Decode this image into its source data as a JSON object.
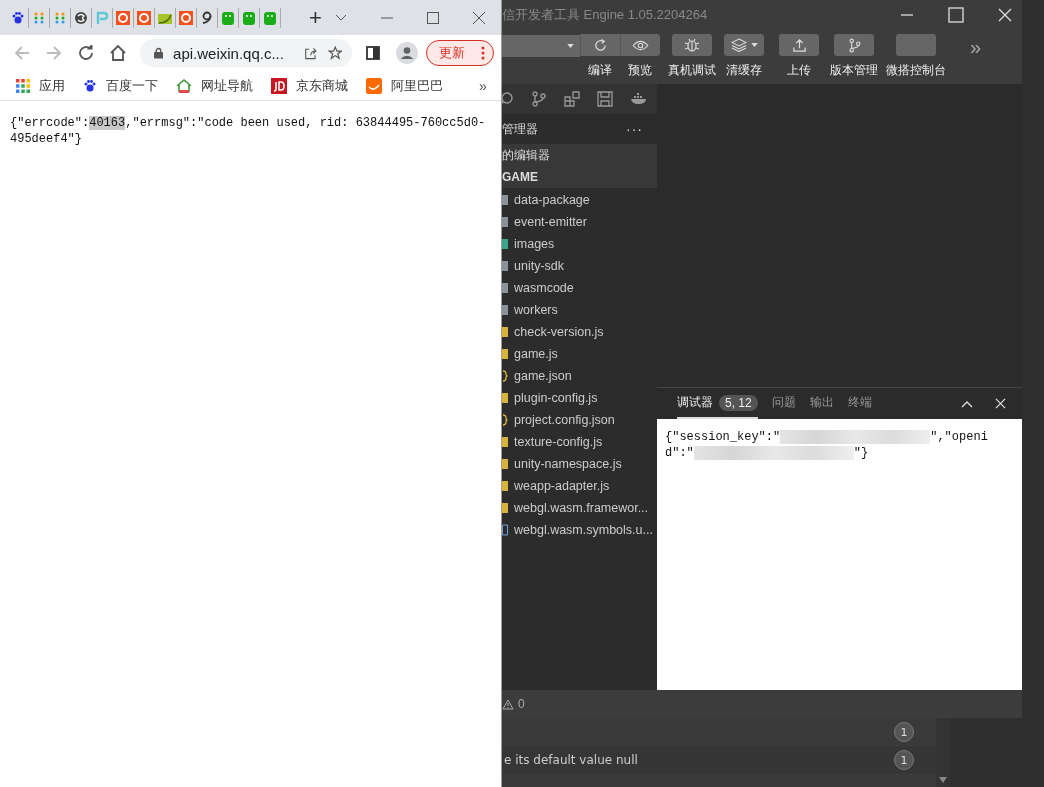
{
  "browser": {
    "tabs": [
      {
        "kind": "paw"
      },
      {
        "kind": "dots"
      },
      {
        "kind": "dots"
      },
      {
        "kind": "swirl"
      },
      {
        "kind": "p"
      },
      {
        "kind": "ring"
      },
      {
        "kind": "ring"
      },
      {
        "kind": "leaf"
      },
      {
        "kind": "ring"
      },
      {
        "kind": "nine"
      },
      {
        "kind": "android"
      },
      {
        "kind": "android"
      },
      {
        "kind": "android"
      }
    ],
    "new_tab": "+",
    "address": "api.weixin.qq.c...",
    "update_button": "更新",
    "bookmarks": [
      {
        "kind": "apps",
        "label": "应用"
      },
      {
        "kind": "paw",
        "label": "百度一下"
      },
      {
        "kind": "house",
        "label": "网址导航"
      },
      {
        "kind": "jd",
        "label": "京东商城"
      },
      {
        "kind": "ali",
        "label": "阿里巴巴"
      }
    ],
    "more": "»",
    "response": {
      "before": "{\"errcode\":",
      "highlight": "40163",
      "after": ",\"errmsg\":\"code been used, rid: 63844495-760cc5d0-495deef4\"}"
    }
  },
  "devtools": {
    "title": "信开发者工具 Engine 1.05.2204264",
    "toolbar": [
      {
        "kind": "compile",
        "label": "编译"
      },
      {
        "kind": "preview",
        "label": "预览"
      },
      {
        "kind": "debug",
        "label": "真机调试"
      },
      {
        "kind": "cache",
        "label": "清缓存"
      },
      {
        "kind": "upload",
        "label": "上传"
      },
      {
        "kind": "branch",
        "label": "版本管理"
      },
      {
        "kind": "blank",
        "label": "微搭控制台"
      }
    ],
    "overflow": "»",
    "explorer": {
      "title": "管理器",
      "menu": "···",
      "open_editors": "的编辑器",
      "folder": "GAME",
      "files": [
        {
          "kind": "folder",
          "name": "data-package"
        },
        {
          "kind": "folder",
          "name": "event-emitter"
        },
        {
          "kind": "image",
          "name": "images"
        },
        {
          "kind": "folder",
          "name": "unity-sdk"
        },
        {
          "kind": "folder",
          "name": "wasmcode"
        },
        {
          "kind": "folder",
          "name": "workers"
        },
        {
          "kind": "js",
          "name": "check-version.js"
        },
        {
          "kind": "js",
          "name": "game.js"
        },
        {
          "kind": "json",
          "name": "game.json"
        },
        {
          "kind": "js",
          "name": "plugin-config.js"
        },
        {
          "kind": "json",
          "name": "project.config.json"
        },
        {
          "kind": "js",
          "name": "texture-config.js"
        },
        {
          "kind": "js",
          "name": "unity-namespace.js"
        },
        {
          "kind": "js",
          "name": "weapp-adapter.js"
        },
        {
          "kind": "js",
          "name": "webgl.wasm.framewor..."
        },
        {
          "kind": "doc",
          "name": "webgl.wasm.symbols.u..."
        }
      ]
    },
    "panel": {
      "tabs": [
        {
          "label": "调试器",
          "badge": "5, 12",
          "selected": true
        },
        {
          "label": "问题",
          "selected": false
        },
        {
          "label": "输出",
          "selected": false
        },
        {
          "label": "终端",
          "selected": false
        }
      ],
      "output": [
        {
          "before": "{\"session_key\":\"",
          "after": "\",\"openi"
        },
        {
          "before": "d\":\"",
          "after": "\"}"
        }
      ]
    },
    "warnings": "0"
  },
  "console": {
    "rows": [
      {
        "text": "",
        "badge": "1"
      },
      {
        "text": "e its default value null",
        "badge": "1"
      }
    ]
  }
}
